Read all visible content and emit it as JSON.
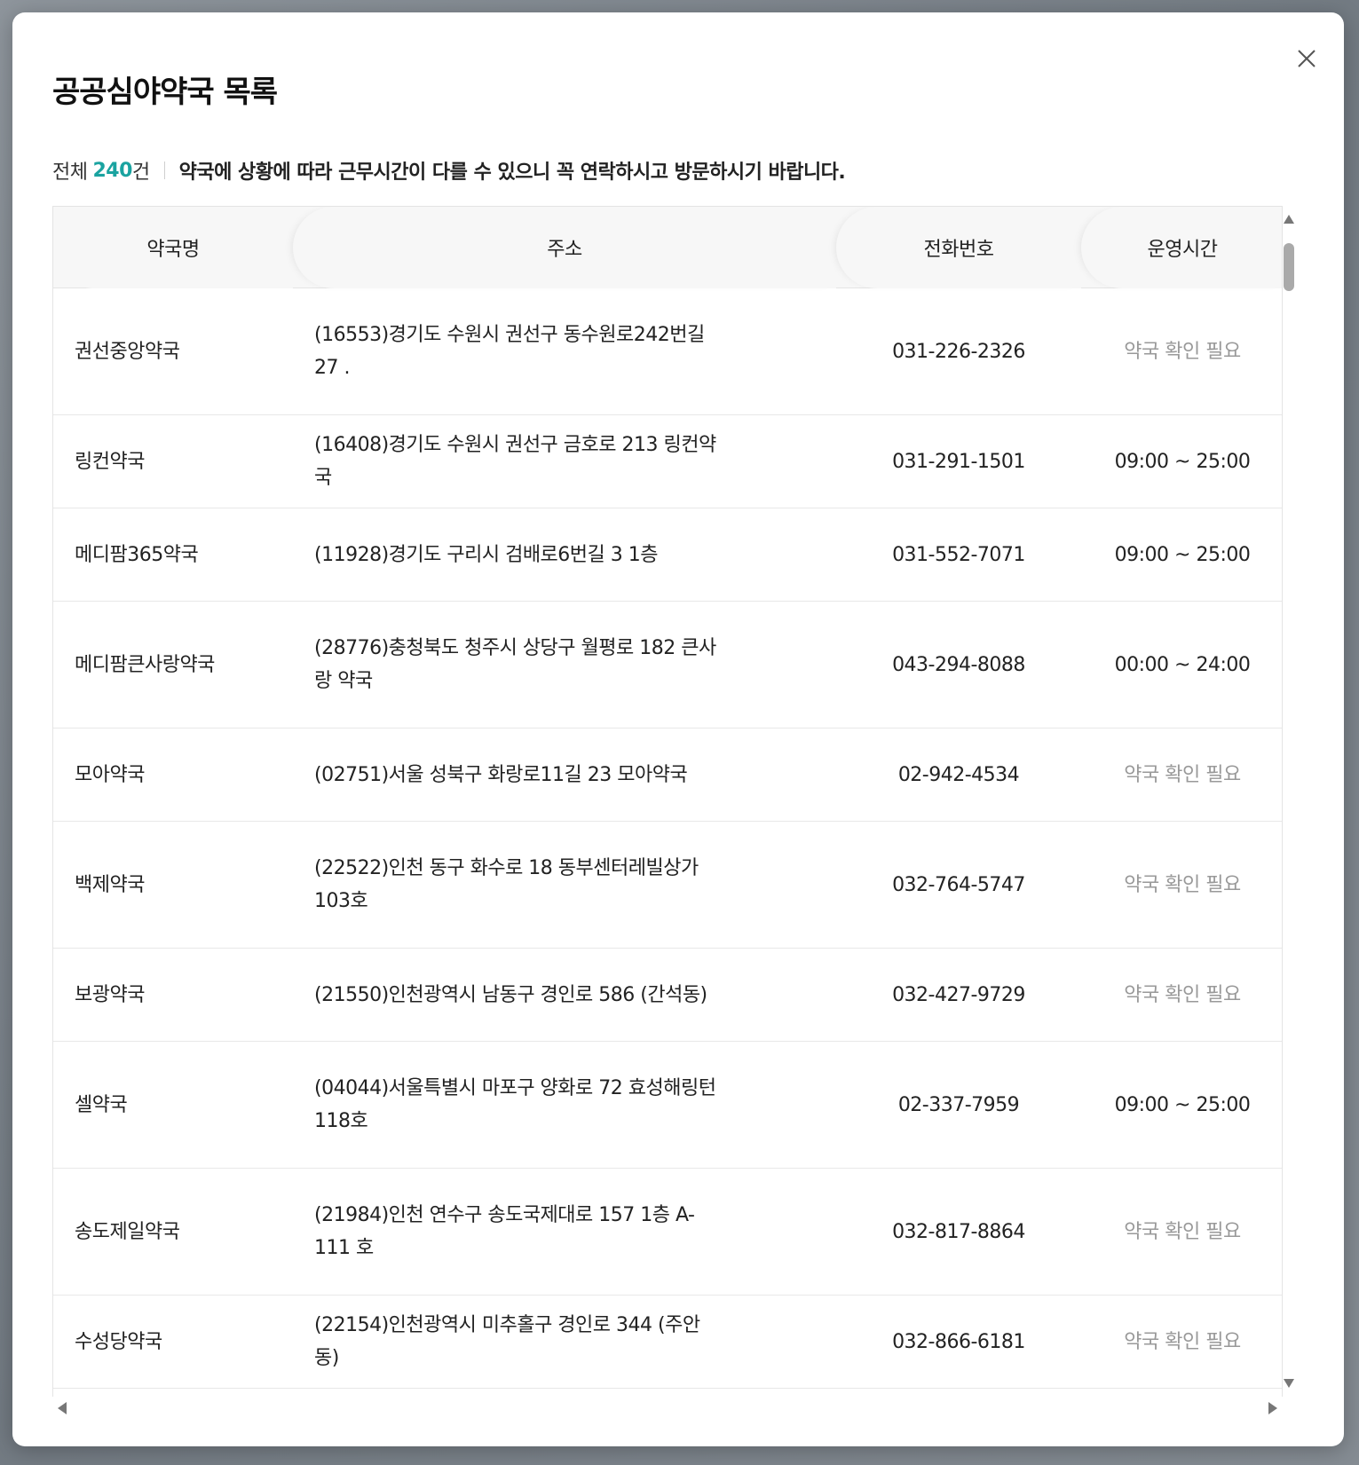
{
  "modal": {
    "title": "공공심야약국 목록",
    "close_icon": "close-icon"
  },
  "summary": {
    "total_prefix": "전체",
    "total_count": "240",
    "total_suffix": "건",
    "notice": "약국에 상황에 따라 근무시간이 다를 수 있으니 꼭 연락하시고 방문하시기 바랍니다."
  },
  "table": {
    "columns": [
      "약국명",
      "주소",
      "전화번호",
      "운영시간"
    ],
    "rows": [
      {
        "name": "권선중앙약국",
        "address": "(16553)경기도 수원시 권선구 동수원로242번길 27 .",
        "phone": "031-226-2326",
        "hours": "약국 확인 필요",
        "hours_muted": true
      },
      {
        "name": "링컨약국",
        "address": "(16408)경기도 수원시 권선구 금호로 213 링컨약국",
        "phone": "031-291-1501",
        "hours": "09:00 ~ 25:00",
        "hours_muted": false
      },
      {
        "name": "메디팜365약국",
        "address": "(11928)경기도 구리시 검배로6번길 3 1층",
        "phone": "031-552-7071",
        "hours": "09:00 ~ 25:00",
        "hours_muted": false
      },
      {
        "name": "메디팜큰사랑약국",
        "address": "(28776)충청북도 청주시 상당구 월평로 182 큰사랑 약국",
        "phone": "043-294-8088",
        "hours": "00:00 ~ 24:00",
        "hours_muted": false
      },
      {
        "name": "모아약국",
        "address": "(02751)서울 성북구 화랑로11길 23 모아약국",
        "phone": "02-942-4534",
        "hours": "약국 확인 필요",
        "hours_muted": true
      },
      {
        "name": "백제약국",
        "address": "(22522)인천 동구 화수로 18 동부센터레빌상가 103호",
        "phone": "032-764-5747",
        "hours": "약국 확인 필요",
        "hours_muted": true
      },
      {
        "name": "보광약국",
        "address": "(21550)인천광역시 남동구 경인로 586 (간석동)",
        "phone": "032-427-9729",
        "hours": "약국 확인 필요",
        "hours_muted": true
      },
      {
        "name": "셀약국",
        "address": "(04044)서울특별시 마포구 양화로 72 효성해링턴 118호",
        "phone": "02-337-7959",
        "hours": "09:00 ~ 25:00",
        "hours_muted": false
      },
      {
        "name": "송도제일약국",
        "address": "(21984)인천 연수구 송도국제대로 157 1층 A-111 호",
        "phone": "032-817-8864",
        "hours": "약국 확인 필요",
        "hours_muted": true
      },
      {
        "name": "수성당약국",
        "address": "(22154)인천광역시 미추홀구 경인로 344 (주안동)",
        "phone": "032-866-6181",
        "hours": "약국 확인 필요",
        "hours_muted": true
      }
    ]
  },
  "colors": {
    "accent": "#1aa3a0",
    "muted_text": "#999999",
    "header_bg": "#f7f7f7"
  }
}
